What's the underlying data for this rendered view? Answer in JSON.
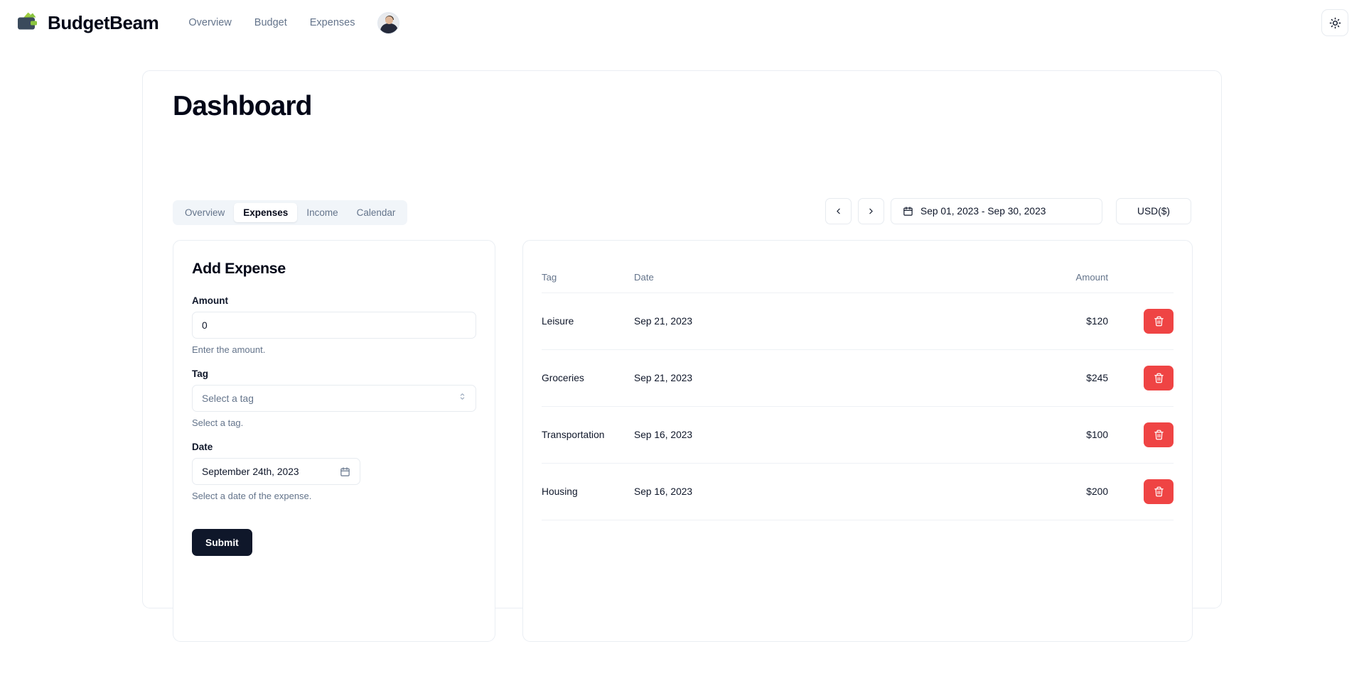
{
  "brand": {
    "name": "BudgetBeam",
    "logo_icon": "wallet-icon",
    "logo_body_color": "#3a4a5c",
    "logo_accent_color": "#8bc53f"
  },
  "nav": {
    "links": [
      {
        "label": "Overview"
      },
      {
        "label": "Budget"
      },
      {
        "label": "Expenses"
      }
    ],
    "avatar_alt": "user-avatar",
    "theme_toggle_icon": "sun-icon"
  },
  "page": {
    "title": "Dashboard"
  },
  "tabs": [
    {
      "label": "Overview",
      "active": false
    },
    {
      "label": "Expenses",
      "active": true
    },
    {
      "label": "Income",
      "active": false
    },
    {
      "label": "Calendar",
      "active": false
    }
  ],
  "date_controls": {
    "prev_label": "‹",
    "next_label": "›",
    "calendar_icon": "calendar-icon",
    "range": "Sep 01, 2023 - Sep 30, 2023",
    "currency": "USD($)"
  },
  "form": {
    "title": "Add Expense",
    "amount": {
      "label": "Amount",
      "value": "0",
      "placeholder": "0",
      "helper": "Enter the amount."
    },
    "tag": {
      "label": "Tag",
      "value": "Select a tag",
      "helper": "Select a tag.",
      "chevron_icon": "chevron-up-down-icon"
    },
    "date": {
      "label": "Date",
      "value": "September 24th, 2023",
      "helper": "Select a date of the expense.",
      "calendar_icon": "calendar-icon"
    },
    "submit_label": "Submit"
  },
  "table": {
    "headers": {
      "tag": "Tag",
      "date": "Date",
      "amount": "Amount"
    },
    "delete_icon": "trash-icon",
    "delete_color": "#ef4444",
    "rows": [
      {
        "tag": "Leisure",
        "date": "Sep 21, 2023",
        "amount": "$120"
      },
      {
        "tag": "Groceries",
        "date": "Sep 21, 2023",
        "amount": "$245"
      },
      {
        "tag": "Transportation",
        "date": "Sep 16, 2023",
        "amount": "$100"
      },
      {
        "tag": "Housing",
        "date": "Sep 16, 2023",
        "amount": "$200"
      }
    ]
  },
  "colors": {
    "accent_dark": "#0f172a",
    "muted_text": "#64748b",
    "border": "#e7ebf0",
    "tab_bg": "#f1f5f9"
  }
}
